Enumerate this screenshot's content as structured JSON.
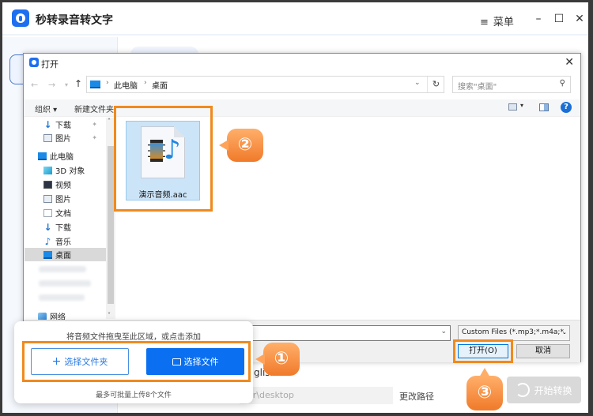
{
  "app": {
    "title": "秒转录音转文字",
    "menu_label": "菜单",
    "menu_icon": "≡",
    "minimize": "–",
    "maximize": "☐",
    "close": "✕",
    "language_label": "glish",
    "output_path": "or\\desktop",
    "change_path_label": "更改路径",
    "start_label": "开始转换"
  },
  "dialog": {
    "title": "打开",
    "close": "✕",
    "nav": {
      "back": "←",
      "forward": "→",
      "recent": "▾",
      "up": "↑"
    },
    "breadcrumb": [
      "此电脑",
      "桌面"
    ],
    "breadcrumb_sep": "›",
    "address_dropdown": "⌄",
    "refresh": "↻",
    "search_placeholder": "搜索\"桌面\"",
    "search_icon": "⚲",
    "toolbar": {
      "organize": "组织 ▾",
      "new_folder": "新建文件夹",
      "view_dropdown": "▾",
      "help": "?"
    },
    "nav_pane": {
      "quick_access": [
        {
          "label": "下载",
          "icon": "download",
          "pinned": true
        },
        {
          "label": "图片",
          "icon": "pictures",
          "pinned": true
        }
      ],
      "this_pc": {
        "label": "此电脑",
        "icon": "pc"
      },
      "pc_items": [
        {
          "label": "3D 对象",
          "icon": "3d-objects"
        },
        {
          "label": "视频",
          "icon": "videos"
        },
        {
          "label": "图片",
          "icon": "pictures"
        },
        {
          "label": "文档",
          "icon": "documents"
        },
        {
          "label": "下载",
          "icon": "download"
        },
        {
          "label": "音乐",
          "icon": "music"
        },
        {
          "label": "桌面",
          "icon": "desktop",
          "selected": true
        }
      ],
      "network": {
        "label": "网络",
        "icon": "network"
      },
      "pin_glyph": "📌",
      "scroll_up": "˄",
      "scroll_down": "˅"
    },
    "files": [
      {
        "name": "演示音频.aac",
        "type": "audio",
        "selected": true
      }
    ],
    "filename_value": "",
    "filter_value": "Custom Files (*.mp3;*.m4a;*.",
    "open_label": "打开(O)",
    "cancel_label": "取消",
    "dropdown_glyph": "⌄"
  },
  "upload_popup": {
    "hint": "将音频文件拖曳至此区域，或点击添加",
    "select_folder_label": "选择文件夹",
    "select_folder_icon": "+",
    "select_file_label": "选择文件",
    "limit_text": "最多可批量上传8个文件"
  },
  "annotations": {
    "step1": "①",
    "step2": "②",
    "step3": "③",
    "highlight_color": "#f08a1e"
  },
  "colors": {
    "brand_blue": "#0a6ff0",
    "badge_orange": "#f07a2a"
  }
}
